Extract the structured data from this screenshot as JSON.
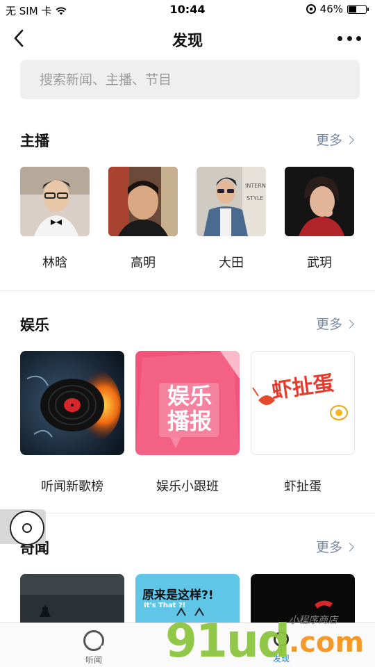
{
  "status_bar": {
    "carrier": "无 SIM 卡",
    "time": "10:44",
    "battery": "46%",
    "battery_level": 0.46
  },
  "nav": {
    "title": "发现"
  },
  "search": {
    "placeholder": "搜索新闻、主播、节目"
  },
  "sections": {
    "anchors": {
      "title": "主播",
      "more": "更多",
      "items": [
        {
          "name": "林晗"
        },
        {
          "name": "高明"
        },
        {
          "name": "大田"
        },
        {
          "name": "武玥"
        }
      ]
    },
    "entertainment": {
      "title": "娱乐",
      "more": "更多",
      "items": [
        {
          "name": "听闻新歌榜",
          "cover_text": ""
        },
        {
          "name": "娱乐小跟班",
          "cover_text": "娱乐播报"
        },
        {
          "name": "虾扯蛋",
          "cover_text": "虾扯蛋"
        }
      ]
    },
    "news": {
      "title": "奇闻",
      "more": "更多",
      "items": [
        {
          "cover_text": ""
        },
        {
          "cover_text": "原来是这样?!",
          "cover_subtext": "It's That ?!"
        },
        {
          "cover_text": ""
        }
      ]
    }
  },
  "tabbar": {
    "tabs": [
      {
        "label": "听闻"
      },
      {
        "label": "发现"
      }
    ]
  },
  "watermark": {
    "brand": "91ud",
    "domain": ".com",
    "slogan": "小程序商店"
  },
  "colors": {
    "link": "#7a8aa3",
    "active_tab": "#1a7fe5",
    "search_bg": "#efefef",
    "ent_card_pink": "#f2537a"
  }
}
